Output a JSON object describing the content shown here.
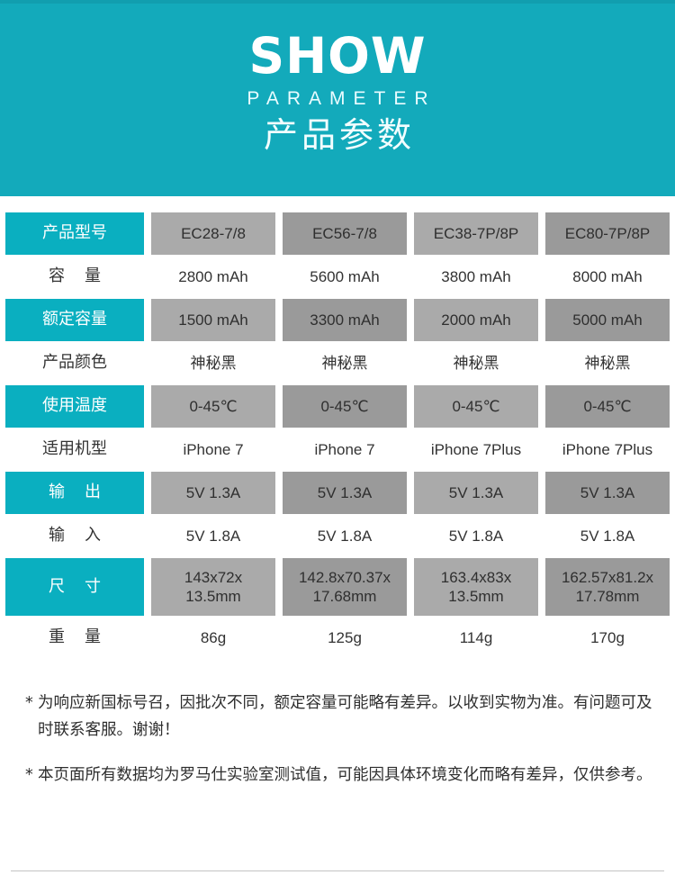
{
  "banner": {
    "title_en": "SHOW",
    "subtitle_en": "PARAMETER",
    "title_cn": "产品参数",
    "bg_color": "#13aabb"
  },
  "table": {
    "label_bg_color": "#0aafc0",
    "cell_bg_light": "#aaaaaa",
    "cell_bg_dark": "#9a9a9a",
    "rows": [
      {
        "label": "产品型号",
        "shaded": true,
        "values": [
          "EC28-7/8",
          "EC56-7/8",
          "EC38-7P/8P",
          "EC80-7P/8P"
        ]
      },
      {
        "label_a": "容",
        "label_b": "量",
        "shaded": false,
        "values": [
          "2800 mAh",
          "5600 mAh",
          "3800 mAh",
          "8000 mAh"
        ]
      },
      {
        "label": "额定容量",
        "shaded": true,
        "values": [
          "1500 mAh",
          "3300 mAh",
          "2000 mAh",
          "5000 mAh"
        ]
      },
      {
        "label": "产品颜色",
        "shaded": false,
        "values": [
          "神秘黑",
          "神秘黑",
          "神秘黑",
          "神秘黑"
        ]
      },
      {
        "label": "使用温度",
        "shaded": true,
        "values": [
          "0-45℃",
          "0-45℃",
          "0-45℃",
          "0-45℃"
        ]
      },
      {
        "label": "适用机型",
        "shaded": false,
        "values": [
          "iPhone 7",
          "iPhone 7",
          "iPhone 7Plus",
          "iPhone 7Plus"
        ]
      },
      {
        "label_a": "输",
        "label_b": "出",
        "shaded": true,
        "values": [
          "5V  1.3A",
          "5V  1.3A",
          "5V  1.3A",
          "5V  1.3A"
        ]
      },
      {
        "label_a": "输",
        "label_b": "入",
        "shaded": false,
        "values": [
          "5V 1.8A",
          "5V 1.8A",
          "5V 1.8A",
          "5V 1.8A"
        ]
      },
      {
        "label_a": "尺",
        "label_b": "寸",
        "shaded": true,
        "tall": true,
        "values_line1": [
          "143x72x",
          "142.8x70.37x",
          "163.4x83x",
          "162.57x81.2x"
        ],
        "values_line2": [
          "13.5mm",
          "17.68mm",
          "13.5mm",
          "17.78mm"
        ]
      },
      {
        "label_a": "重",
        "label_b": "量",
        "shaded": false,
        "values": [
          "86g",
          "125g",
          "114g",
          "170g"
        ]
      }
    ]
  },
  "notes": {
    "star": "*",
    "note1": "为响应新国标号召，因批次不同，额定容量可能略有差异。以收到实物为准。有问题可及时联系客服。谢谢！",
    "note2": "本页面所有数据均为罗马仕实验室测试值，可能因具体环境变化而略有差异，仅供参考。"
  }
}
